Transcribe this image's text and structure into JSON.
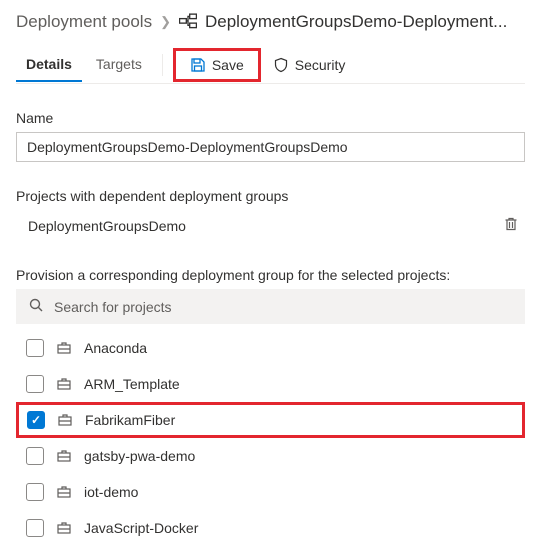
{
  "breadcrumb": {
    "root": "Deployment pools",
    "current": "DeploymentGroupsDemo-Deployment..."
  },
  "tabs": {
    "details": "Details",
    "targets": "Targets"
  },
  "toolbar": {
    "save": "Save",
    "security": "Security"
  },
  "nameField": {
    "label": "Name",
    "value": "DeploymentGroupsDemo-DeploymentGroupsDemo"
  },
  "dependent": {
    "label": "Projects with dependent deployment groups",
    "items": [
      "DeploymentGroupsDemo"
    ]
  },
  "provision": {
    "label": "Provision a corresponding deployment group for the selected projects:",
    "searchPlaceholder": "Search for projects",
    "projects": [
      {
        "name": "Anaconda",
        "checked": false
      },
      {
        "name": "ARM_Template",
        "checked": false
      },
      {
        "name": "FabrikamFiber",
        "checked": true,
        "highlight": true
      },
      {
        "name": "gatsby-pwa-demo",
        "checked": false
      },
      {
        "name": "iot-demo",
        "checked": false
      },
      {
        "name": "JavaScript-Docker",
        "checked": false
      }
    ]
  }
}
